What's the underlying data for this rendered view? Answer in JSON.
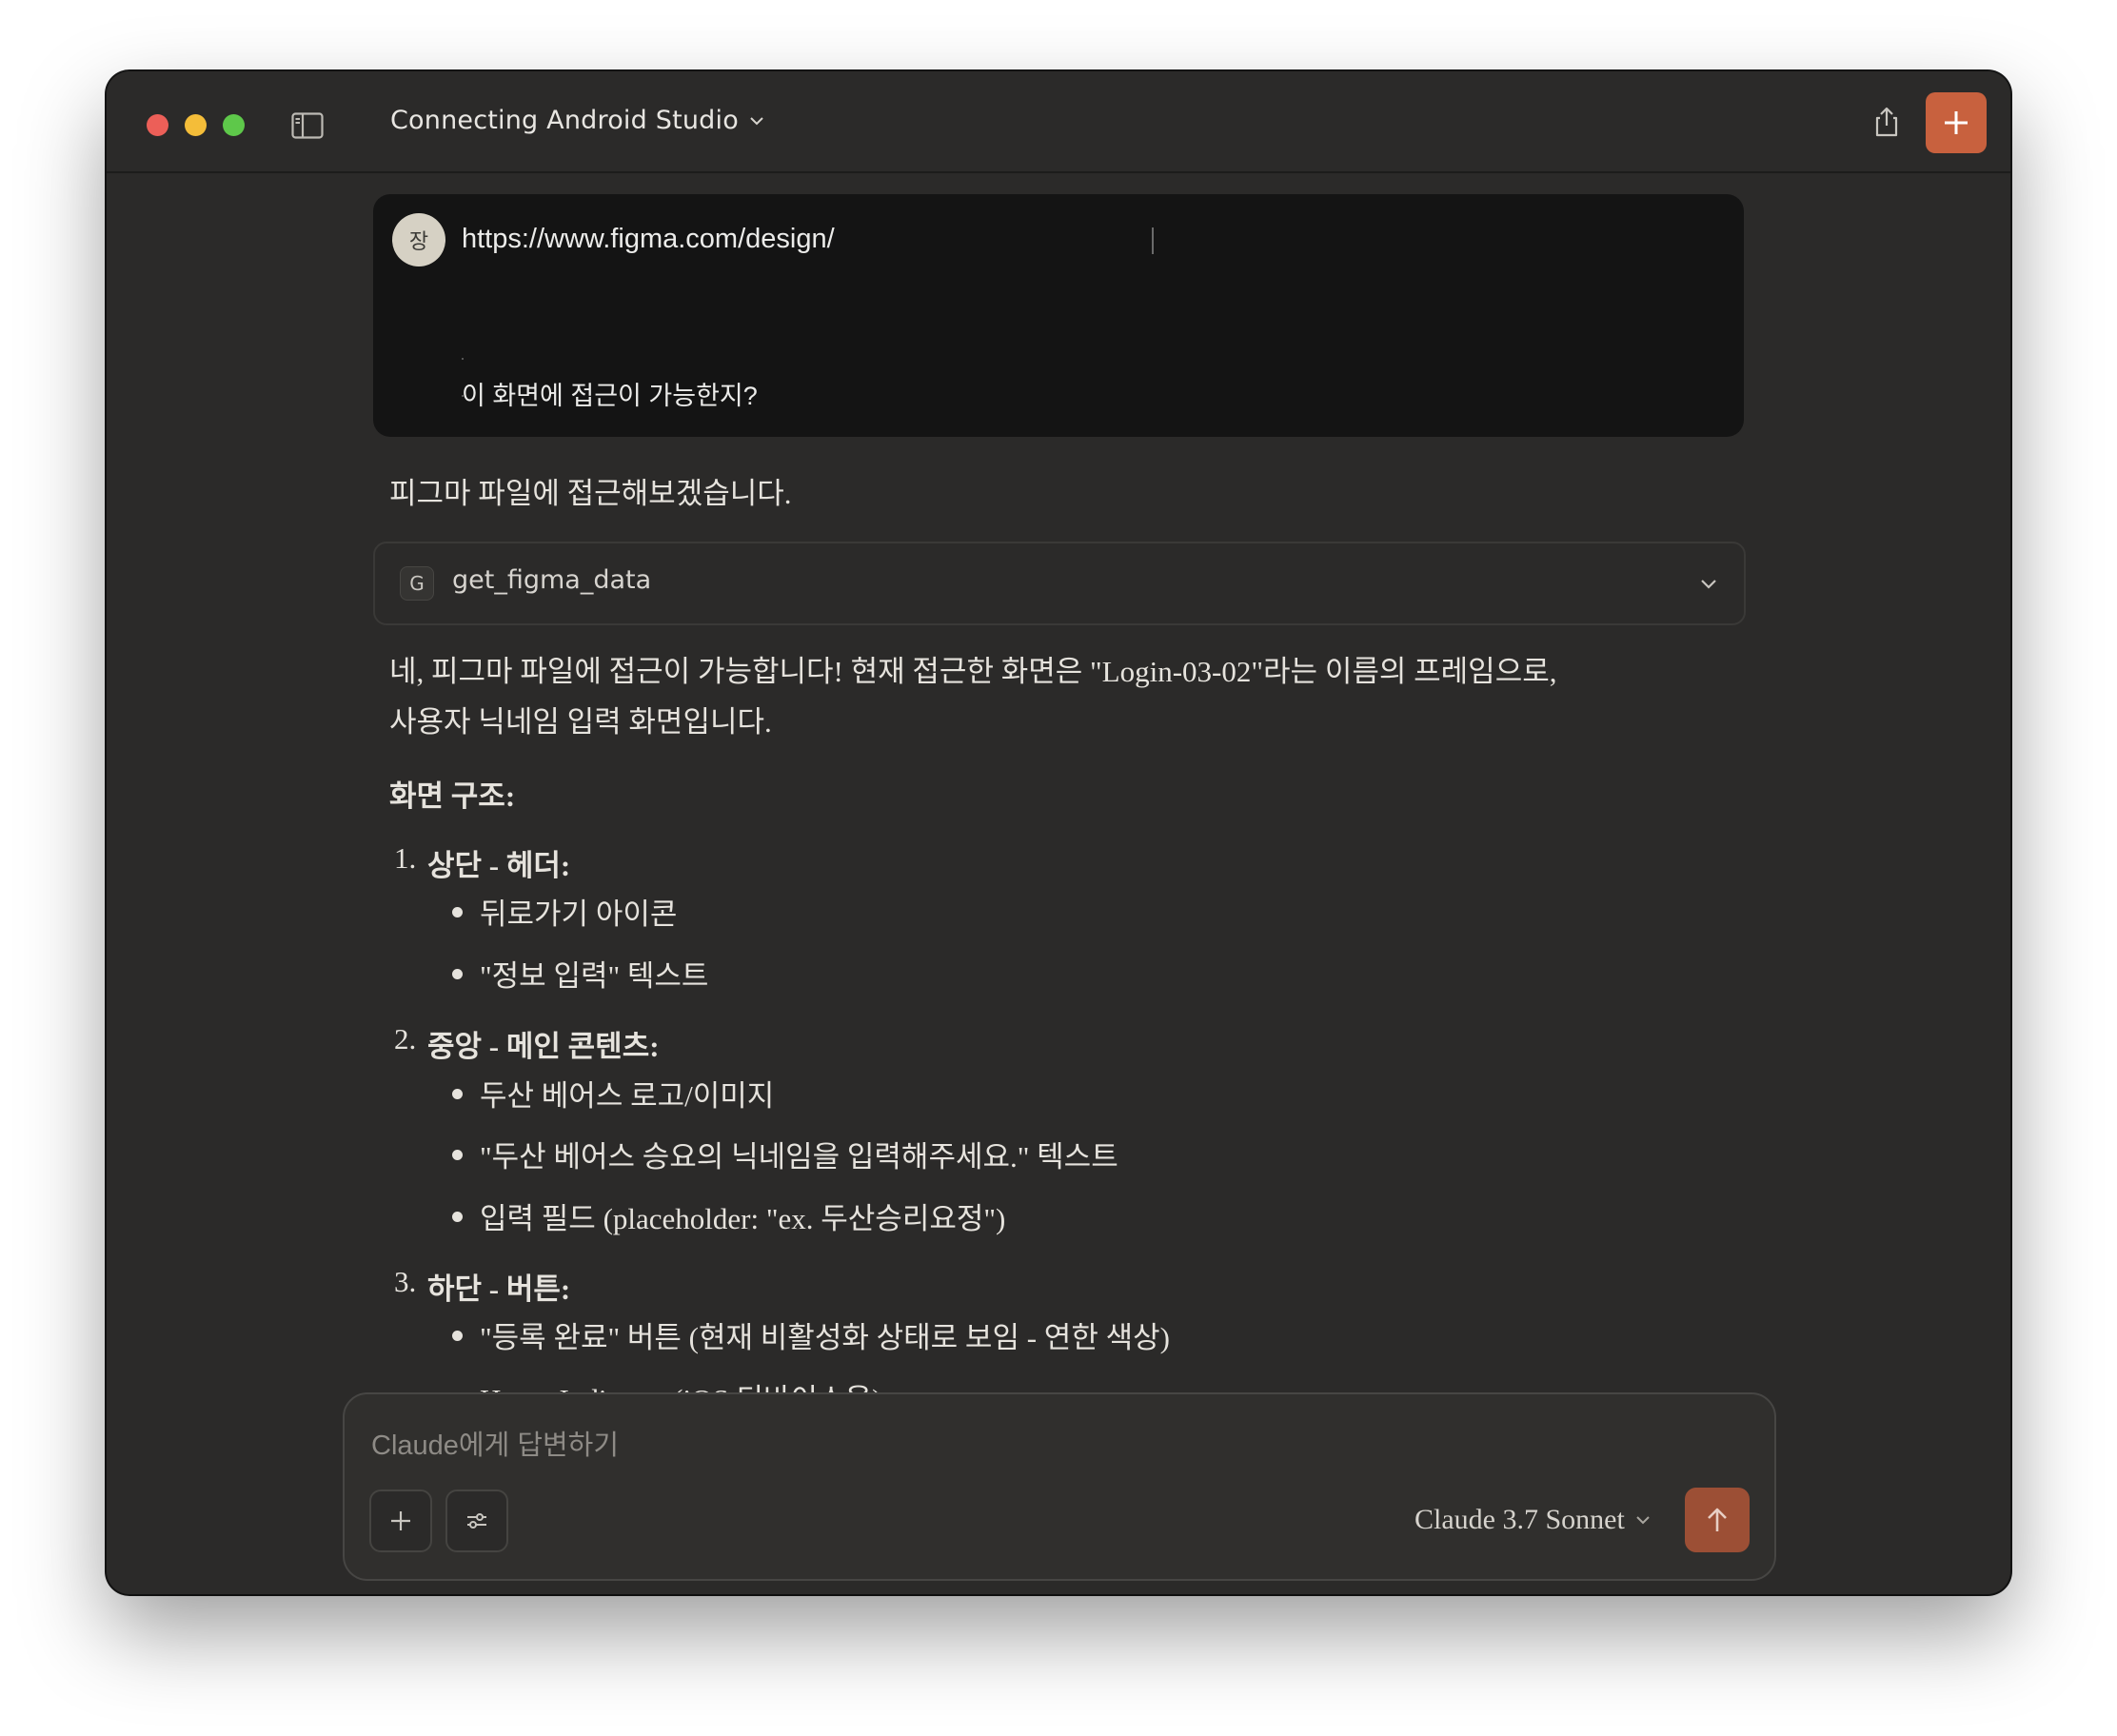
{
  "window": {
    "title": "Connecting Android Studio"
  },
  "user_message": {
    "avatar_initial": "장",
    "url": "https://www.figma.com/design/",
    "question": "이 화면에 접근이 가능한지?"
  },
  "assistant": {
    "intro": "피그마 파일에 접근해보겠습니다.",
    "tool_call": {
      "badge": "G",
      "name": "get_figma_data"
    },
    "answer_line1": "네, 피그마 파일에 접근이 가능합니다! 현재 접근한 화면은 \"Login-03-02\"라는 이름의 프레임으로,",
    "answer_line2": "사용자 닉네임 입력 화면입니다.",
    "structure_heading": "화면 구조:",
    "sections": [
      {
        "number": "1.",
        "title": "상단 - 헤더:",
        "items": [
          "뒤로가기 아이콘",
          "\"정보 입력\" 텍스트"
        ]
      },
      {
        "number": "2.",
        "title": "중앙 - 메인 콘텐츠:",
        "items": [
          "두산 베어스 로고/이미지",
          "\"두산 베어스 승요의 닉네임을 입력해주세요.\" 텍스트",
          "입력 필드 (placeholder: \"ex. 두산승리요정\")"
        ]
      },
      {
        "number": "3.",
        "title": "하단 - 버튼:",
        "items": [
          "\"등록 완료\" 버튼 (현재 비활성화 상태로 보임 - 연한 색상)",
          "Home Indicator (iOS 디바이스용)"
        ]
      }
    ]
  },
  "composer": {
    "placeholder": "Claude에게 답변하기",
    "model": "Claude 3.7 Sonnet"
  },
  "colors": {
    "accent": "#c8613e",
    "send_button": "#9c4f35",
    "window_bg": "#2b2a29",
    "user_bubble": "#141414"
  },
  "icons": [
    "sidebar-toggle-icon",
    "chevron-down-icon",
    "share-icon",
    "plus-icon",
    "sliders-icon",
    "arrow-up-icon"
  ]
}
